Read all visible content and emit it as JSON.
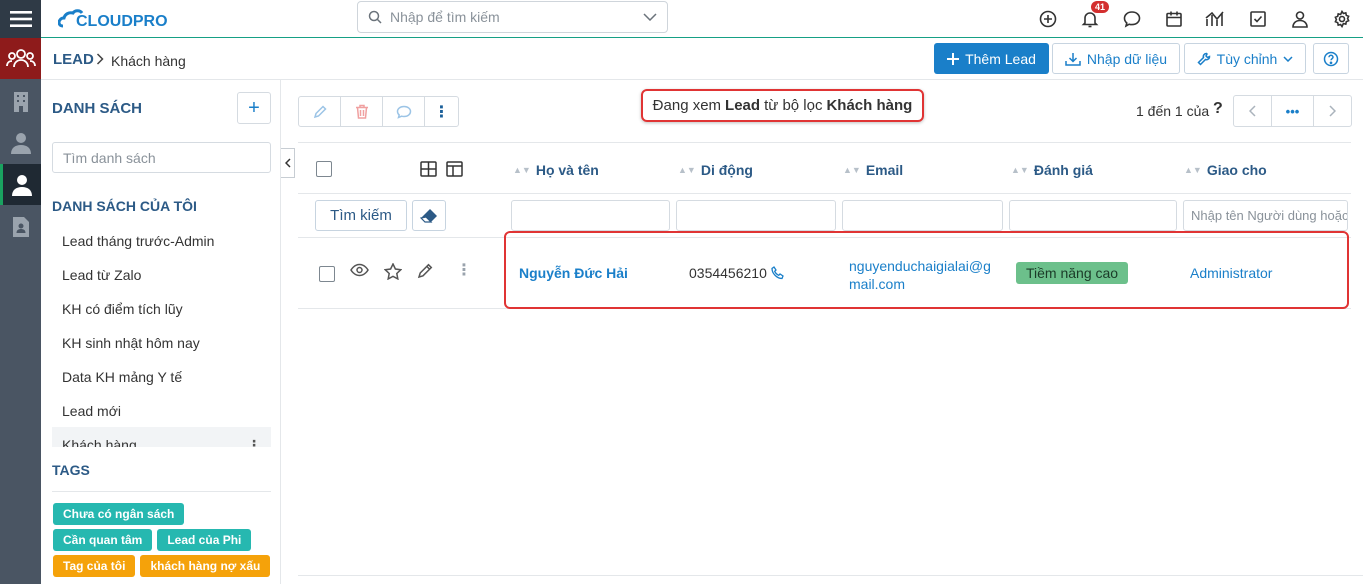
{
  "app": {
    "brand": "CLOUDPRO",
    "colors": {
      "primary": "#1a7fc9",
      "heading": "#2c5a86",
      "accent_red": "#e03434",
      "rail": "#4a5563",
      "active_rail": "#8e1b1b"
    }
  },
  "topbar": {
    "search_placeholder": "Nhập để tìm kiếm",
    "notification_count": "41",
    "icons": [
      "plus-circle-icon",
      "bell-icon",
      "chat-icon",
      "calendar-icon",
      "chart-icon",
      "checkbox-icon",
      "user-icon",
      "gear-icon"
    ]
  },
  "breadcrumb": {
    "module": "LEAD",
    "current": "Khách hàng"
  },
  "actions": {
    "add_lead": "Thêm Lead",
    "import": "Nhập dữ liệu",
    "customize": "Tùy chỉnh"
  },
  "sidebar": {
    "title": "DANH SÁCH",
    "search_placeholder": "Tìm danh sách",
    "my_lists_title": "DANH SÁCH CỦA TÔI",
    "items": [
      {
        "label": "Lead tháng trước-Admin"
      },
      {
        "label": "Lead từ Zalo"
      },
      {
        "label": "KH có điểm tích lũy"
      },
      {
        "label": "KH sinh nhật hôm nay"
      },
      {
        "label": "Data KH mảng Y tế"
      },
      {
        "label": "Lead mới"
      },
      {
        "label": "Khách hàng"
      }
    ],
    "tags_title": "TAGS",
    "tags": [
      {
        "label": "Chưa có ngân sách",
        "color": "teal"
      },
      {
        "label": "Cần quan tâm",
        "color": "teal"
      },
      {
        "label": "Lead của Phi",
        "color": "teal"
      },
      {
        "label": "Tag của tôi",
        "color": "orange"
      },
      {
        "label": "khách hàng nợ xấu",
        "color": "orange"
      }
    ]
  },
  "filter_message": {
    "prefix": "Đang xem",
    "module": "Lead",
    "middle": "từ bộ lọc",
    "filter": "Khách hàng"
  },
  "pagination": {
    "text": "1 đến 1 của",
    "help": "?"
  },
  "table": {
    "columns": [
      "Họ và tên",
      "Di động",
      "Email",
      "Đánh giá",
      "Giao cho"
    ],
    "search_button": "Tìm kiếm",
    "assign_placeholder": "Nhập tên Người dùng hoặc Nhóm",
    "rows": [
      {
        "name": "Nguyễn Đức Hải",
        "phone": "0354456210",
        "email": "nguyenduchaigialai@gmail.com",
        "rating": "Tiềm năng cao",
        "assigned": "Administrator"
      }
    ]
  }
}
